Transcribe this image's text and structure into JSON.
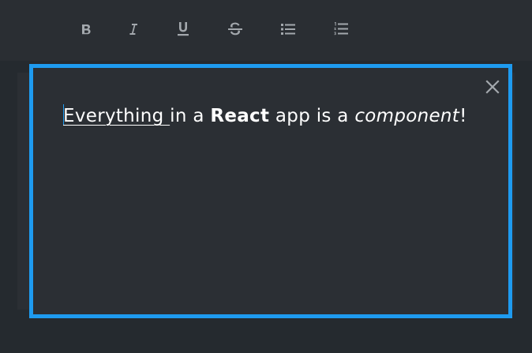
{
  "toolbar": {
    "buttons": [
      {
        "id": "bold",
        "icon": "bold-icon"
      },
      {
        "id": "italic",
        "icon": "italic-icon"
      },
      {
        "id": "underline",
        "icon": "underline-icon"
      },
      {
        "id": "strikethrough",
        "icon": "strikethrough-icon"
      },
      {
        "id": "bulleted-list",
        "icon": "bulleted-list-icon"
      },
      {
        "id": "numbered-list",
        "icon": "numbered-list-icon"
      }
    ]
  },
  "editor": {
    "accent_color": "#1e9bf0",
    "close_icon": "close-icon",
    "content": {
      "underlined": "Everything ",
      "text_1": "in a ",
      "bold": "React",
      "text_2": " app is a ",
      "italic": "component",
      "text_3": "!"
    }
  }
}
